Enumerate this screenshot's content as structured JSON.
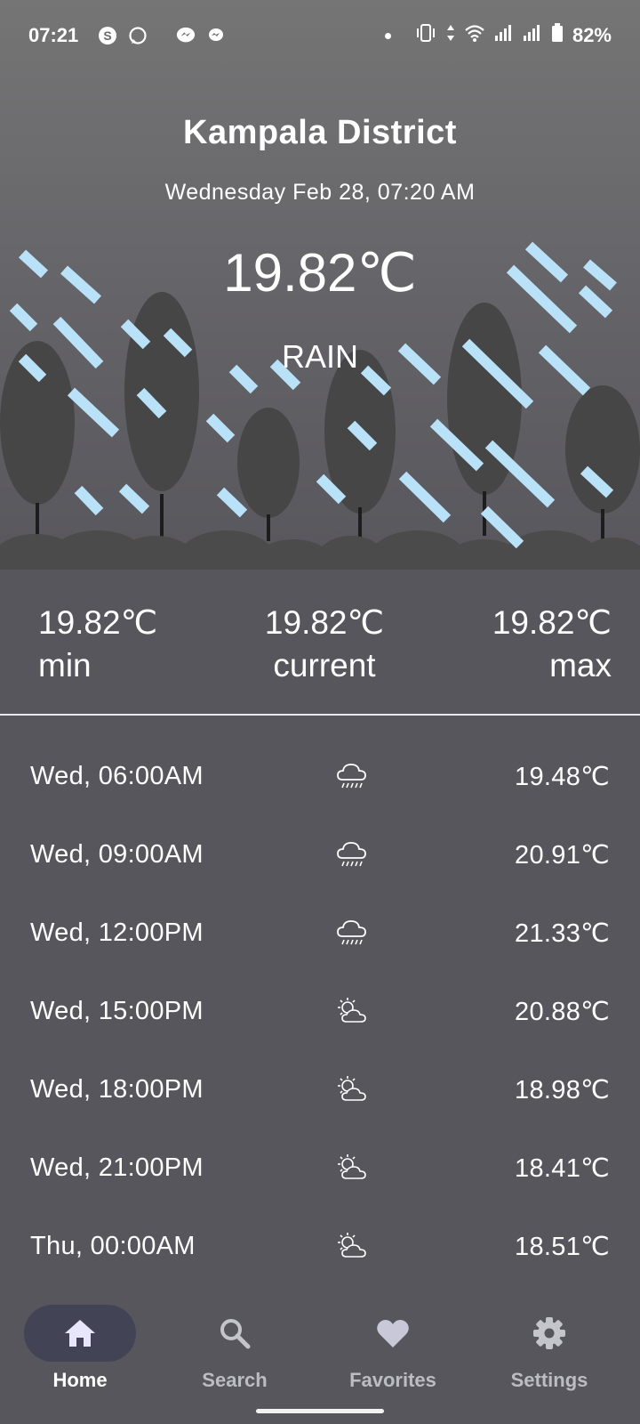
{
  "status_bar": {
    "time": "07:21",
    "battery": "82%",
    "icons": [
      "skype-icon",
      "whatsapp-icon",
      "messenger-icon",
      "messenger-icon",
      "dot-icon",
      "vibrate-icon",
      "data-arrows-icon",
      "wifi-icon",
      "signal-icon",
      "signal-icon",
      "battery-icon"
    ]
  },
  "hero": {
    "location": "Kampala District",
    "datetime": "Wednesday Feb 28, 07:20 AM",
    "temperature": "19.82℃",
    "condition": "RAIN"
  },
  "summary": {
    "min": {
      "value": "19.82℃",
      "label": "min"
    },
    "current": {
      "value": "19.82℃",
      "label": "current"
    },
    "max": {
      "value": "19.82℃",
      "label": "max"
    }
  },
  "forecast": [
    {
      "time": "Wed, 06:00AM",
      "icon": "rain-cloud-icon",
      "temp": "19.48℃"
    },
    {
      "time": "Wed, 09:00AM",
      "icon": "rain-cloud-icon",
      "temp": "20.91℃"
    },
    {
      "time": "Wed, 12:00PM",
      "icon": "rain-cloud-icon",
      "temp": "21.33℃"
    },
    {
      "time": "Wed, 15:00PM",
      "icon": "partly-sunny-icon",
      "temp": "20.88℃"
    },
    {
      "time": "Wed, 18:00PM",
      "icon": "partly-sunny-icon",
      "temp": "18.98℃"
    },
    {
      "time": "Wed, 21:00PM",
      "icon": "partly-sunny-icon",
      "temp": "18.41℃"
    },
    {
      "time": "Thu, 00:00AM",
      "icon": "partly-sunny-icon",
      "temp": "18.51℃"
    }
  ],
  "nav": {
    "items": [
      {
        "label": "Home",
        "icon": "home-icon",
        "active": true
      },
      {
        "label": "Search",
        "icon": "search-icon",
        "active": false
      },
      {
        "label": "Favorites",
        "icon": "heart-icon",
        "active": false
      },
      {
        "label": "Settings",
        "icon": "gear-icon",
        "active": false
      }
    ]
  },
  "colors": {
    "background": "#57565c",
    "rain": "#b9e1f8",
    "tree": "#464646",
    "nav_active": "#434356"
  }
}
